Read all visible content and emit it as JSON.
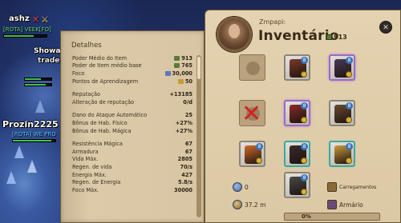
{
  "world": {
    "players": [
      {
        "name": "ashz",
        "guild": "[ROTA] VEEK[FO]"
      },
      {
        "name": "Showa",
        "guild": "trade"
      },
      {
        "name": "Prozin2225",
        "guild": "[ROTA] WE PRO"
      }
    ]
  },
  "details": {
    "title": "Detalhes",
    "rows": [
      {
        "label": "Poder Médio do Item",
        "value": "913",
        "icon": "gear-score-icon",
        "icon_color": "#5b7a3a"
      },
      {
        "label": "Poder de Item médio base",
        "value": "765",
        "icon": "gear-score-icon",
        "icon_color": "#5b7a3a"
      },
      {
        "label": "Foco",
        "value": "30,000",
        "icon": "focus-icon",
        "icon_color": "#5a7ab8"
      },
      {
        "label": "Pontos de Aprendizagem",
        "value": "50",
        "icon": "learning-points-icon",
        "icon_color": "#c89a3a"
      },
      {
        "label": "Reputação",
        "value": "+13185",
        "gap": true
      },
      {
        "label": "Alteração de reputação",
        "value": "0/d"
      },
      {
        "label": "Dano do Ataque Automático",
        "value": "25",
        "gap": true
      },
      {
        "label": "Bônus de Hab. Físico",
        "value": "+27%"
      },
      {
        "label": "Bônus de Hab. Mágica",
        "value": "+27%"
      },
      {
        "label": "Resistência Mágica",
        "value": "67",
        "gap": true
      },
      {
        "label": "Armadura",
        "value": "67"
      },
      {
        "label": "Vida Máx.",
        "value": "2805"
      },
      {
        "label": "Regen. de vida",
        "value": "70/s"
      },
      {
        "label": "Energia Máx.",
        "value": "427"
      },
      {
        "label": "Regen. de Energia",
        "value": "5.8/s"
      },
      {
        "label": "Foco Máx.",
        "value": "30000"
      }
    ]
  },
  "inventory": {
    "player_name": "Zmpapi:",
    "title": "Inventário",
    "item_power": "913",
    "close_icon": "close-icon",
    "slots": [
      {
        "name": "bag-slot",
        "state": "empty",
        "color": ""
      },
      {
        "name": "head-slot",
        "state": "filled",
        "tier": "8",
        "color": "#7a3a2a"
      },
      {
        "name": "cape-slot",
        "state": "filled",
        "tier": "8",
        "color": "#4a3a5a",
        "quality": "purple"
      },
      {
        "name": "main-hand-slot",
        "state": "disabled",
        "color": ""
      },
      {
        "name": "chest-slot",
        "state": "filled",
        "tier": "8",
        "color": "#8a2a2a",
        "quality": "purple"
      },
      {
        "name": "off-hand-slot",
        "state": "filled",
        "tier": "8",
        "color": "#6a4a30"
      },
      {
        "name": "potion-slot",
        "state": "filled",
        "tier": "8",
        "color": "#d06a2a"
      },
      {
        "name": "boots-slot",
        "state": "filled",
        "tier": "8",
        "color": "#3a2a2a",
        "quality": "teal"
      },
      {
        "name": "food-slot",
        "state": "filled",
        "tier": "8",
        "color": "#c89a3a",
        "quality": "teal"
      },
      {
        "name": "mount-slot",
        "state": "filled",
        "tier": "8",
        "color": "#4a4a4a"
      }
    ],
    "silver": "0",
    "weight": "37.2 m",
    "loadouts_label": "Carregamentos",
    "wardrobe_label": "Armário",
    "load_percent": "0%"
  }
}
